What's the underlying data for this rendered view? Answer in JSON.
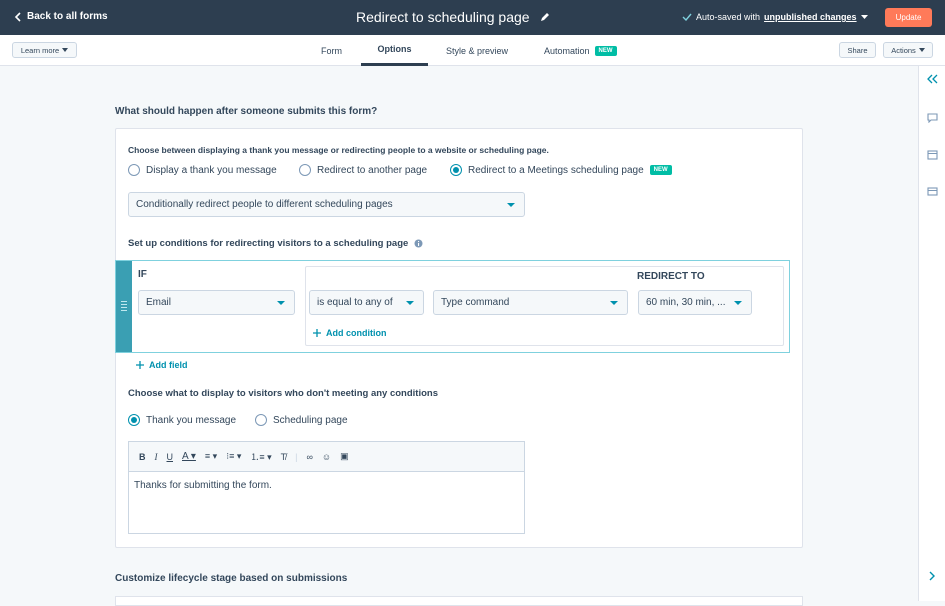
{
  "header": {
    "back_label": "Back to all forms",
    "title": "Redirect to scheduling page",
    "autosave_prefix": "Auto-saved with",
    "autosave_link": "unpublished changes",
    "update_label": "Update"
  },
  "toolbar": {
    "learn_more": "Learn more",
    "share": "Share",
    "actions": "Actions"
  },
  "tabs": [
    {
      "label": "Form"
    },
    {
      "label": "Options"
    },
    {
      "label": "Style & preview"
    },
    {
      "label": "Automation",
      "badge": "NEW"
    }
  ],
  "section": {
    "title": "What should happen after someone submits this form?"
  },
  "choice": {
    "label": "Choose between displaying a thank you message or redirecting people to a website or scheduling page.",
    "options": [
      "Display a thank you message",
      "Redirect to another page",
      "Redirect to a Meetings scheduling page"
    ],
    "new_badge": "NEW",
    "dropdown": "Conditionally redirect people to different scheduling pages"
  },
  "conditions": {
    "title": "Set up conditions for redirecting visitors to a scheduling page",
    "if_label": "IF",
    "redirect_label": "REDIRECT TO",
    "field": "Email",
    "operator": "is equal to any of",
    "value": "Type command",
    "target": "60 min, 30 min, ...",
    "add_condition": "Add condition",
    "add_field": "Add field"
  },
  "fallback": {
    "title": "Choose what to display to visitors who don't meeting any conditions",
    "options": [
      "Thank you message",
      "Scheduling page"
    ],
    "editor_text": "Thanks for submitting the form."
  },
  "lifecycle": {
    "title": "Customize lifecycle stage based on submissions"
  }
}
